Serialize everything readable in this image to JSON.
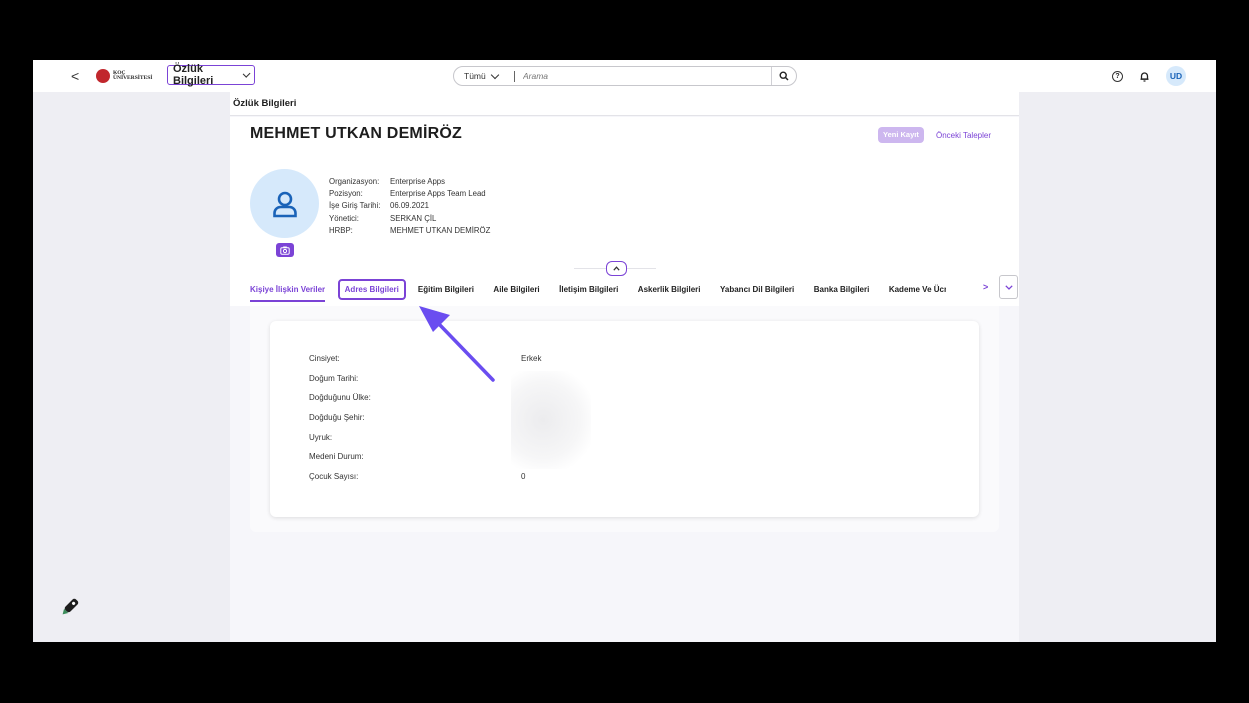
{
  "shell": {
    "back_label": "<",
    "logo_line1": "KOÇ",
    "logo_line2": "ÜNİVERSİTESİ",
    "app_title": "Özlük Bilgileri",
    "search_scope": "Tümü",
    "search_placeholder": "Arama",
    "help_label": "?",
    "user_initials": "UD"
  },
  "page": {
    "title": "Özlük Bilgileri"
  },
  "person": {
    "name": "MEHMET UTKAN DEMİRÖZ",
    "new_record_label": "Yeni Kayıt",
    "previous_requests_label": "Önceki Talepler",
    "info": [
      {
        "label": "Organizasyon:",
        "value": "Enterprise Apps"
      },
      {
        "label": "Pozisyon:",
        "value": "Enterprise Apps Team Lead"
      },
      {
        "label": "İşe Giriş Tarihi:",
        "value": "06.09.2021"
      },
      {
        "label": "Yönetici:",
        "value": "SERKAN ÇİL"
      },
      {
        "label": "HRBP:",
        "value": "MEHMET UTKAN DEMİRÖZ"
      }
    ]
  },
  "tabs": [
    {
      "label": "Kişiye İlişkin Veriler"
    },
    {
      "label": "Adres Bilgileri"
    },
    {
      "label": "Eğitim Bilgileri"
    },
    {
      "label": "Aile Bilgileri"
    },
    {
      "label": "İletişim Bilgileri"
    },
    {
      "label": "Askerlik Bilgileri"
    },
    {
      "label": "Yabancı Dil Bilgileri"
    },
    {
      "label": "Banka Bilgileri"
    },
    {
      "label": "Kademe Ve Ücret"
    }
  ],
  "tab_next_label": ">",
  "personal": [
    {
      "label": "Cinsiyet:",
      "value": "Erkek"
    },
    {
      "label": "Doğum Tarihi:",
      "value": ""
    },
    {
      "label": "Doğduğunu Ülke:",
      "value": ""
    },
    {
      "label": "Doğduğu Şehir:",
      "value": ""
    },
    {
      "label": "Uyruk:",
      "value": ""
    },
    {
      "label": "Medeni Durum:",
      "value": ""
    },
    {
      "label": "Çocuk Sayısı:",
      "value": "0"
    }
  ],
  "colors": {
    "accent": "#7b43d6",
    "annotation_arrow": "#6a4df0",
    "avatar_bg": "#d6e9fb",
    "avatar_fg": "#1a63b8"
  }
}
